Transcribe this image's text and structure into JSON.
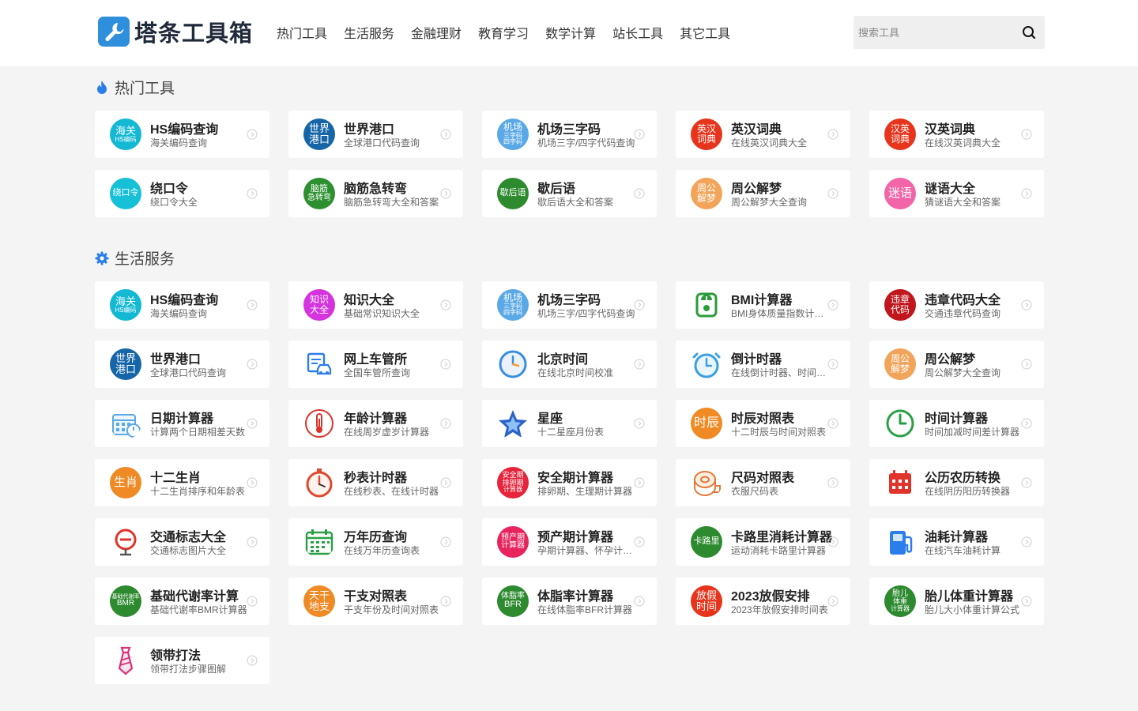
{
  "brand": {
    "logo_text": "塔条工具箱",
    "logo_mark_color": "#2f8fdc"
  },
  "nav": [
    "热门工具",
    "生活服务",
    "金融理财",
    "教育学习",
    "数学计算",
    "站长工具",
    "其它工具"
  ],
  "search": {
    "placeholder": "搜索工具"
  },
  "sections": [
    {
      "title": "热门工具",
      "icon": "flame-icon",
      "icon_color": "#2b7de9",
      "items": [
        {
          "title": "HS编码查询",
          "desc": "海关编码查询",
          "icon": {
            "lines": [
              "海关",
              "HS编码"
            ],
            "bg": "#13b8d3",
            "sizes": [
              13,
              8
            ]
          }
        },
        {
          "title": "世界港口",
          "desc": "全球港口代码查询",
          "icon": {
            "lines": [
              "世界",
              "港口"
            ],
            "bg": "#1565a8",
            "sizes": [
              13,
              13
            ]
          }
        },
        {
          "title": "机场三字码",
          "desc": "机场三字/四字代码查询",
          "icon": {
            "lines": [
              "机场",
              "三字码",
              "四字码"
            ],
            "bg": "#5aa8e6",
            "sizes": [
              12,
              8,
              8
            ]
          }
        },
        {
          "title": "英汉词典",
          "desc": "在线英汉词典大全",
          "icon": {
            "lines": [
              "英汉",
              "词典"
            ],
            "bg": "#e8341c",
            "sizes": [
              12,
              12
            ]
          }
        },
        {
          "title": "汉英词典",
          "desc": "在线汉英词典大全",
          "icon": {
            "lines": [
              "汉英",
              "词典"
            ],
            "bg": "#e8341c",
            "sizes": [
              12,
              12
            ]
          }
        },
        {
          "title": "绕口令",
          "desc": "绕口令大全",
          "icon": {
            "lines": [
              "绕口令"
            ],
            "bg": "#16c0d6",
            "sizes": [
              11
            ]
          }
        },
        {
          "title": "脑筋急转弯",
          "desc": "脑筋急转弯大全和答案",
          "icon": {
            "lines": [
              "脑筋",
              "急转弯"
            ],
            "bg": "#2d8f2f",
            "sizes": [
              11,
              10
            ]
          }
        },
        {
          "title": "歇后语",
          "desc": "歇后语大全和答案",
          "icon": {
            "lines": [
              "歇后语"
            ],
            "bg": "#2d8a2f",
            "sizes": [
              11
            ]
          }
        },
        {
          "title": "周公解梦",
          "desc": "周公解梦大全查询",
          "icon": {
            "lines": [
              "周公",
              "解梦"
            ],
            "bg": "#f2a55a",
            "sizes": [
              12,
              12
            ]
          }
        },
        {
          "title": "谜语大全",
          "desc": "猜谜语大全和答案",
          "icon": {
            "lines": [
              "迷语"
            ],
            "bg": "#f265a8",
            "sizes": [
              15
            ]
          }
        }
      ]
    },
    {
      "title": "生活服务",
      "icon": "gear-icon",
      "icon_color": "#2b7de9",
      "items": [
        {
          "title": "HS编码查询",
          "desc": "海关编码查询",
          "icon": {
            "lines": [
              "海关",
              "HS编码"
            ],
            "bg": "#13b8d3",
            "sizes": [
              13,
              8
            ]
          }
        },
        {
          "title": "知识大全",
          "desc": "基础常识知识大全",
          "icon": {
            "lines": [
              "知识",
              "大全"
            ],
            "bg": "#d633e0",
            "sizes": [
              12,
              12
            ]
          }
        },
        {
          "title": "机场三字码",
          "desc": "机场三字/四字代码查询",
          "icon": {
            "lines": [
              "机场",
              "三字码",
              "四字码"
            ],
            "bg": "#5aa8e6",
            "sizes": [
              12,
              8,
              8
            ]
          }
        },
        {
          "title": "BMI计算器",
          "desc": "BMI身体质量指数计算器",
          "icon": {
            "glyph": "scale-icon",
            "color": "#2a9b3a"
          }
        },
        {
          "title": "违章代码大全",
          "desc": "交通违章代码查询",
          "icon": {
            "lines": [
              "违章",
              "代码"
            ],
            "bg": "#c0161c",
            "sizes": [
              12,
              12
            ]
          }
        },
        {
          "title": "世界港口",
          "desc": "全球港口代码查询",
          "icon": {
            "lines": [
              "世界",
              "港口"
            ],
            "bg": "#1565a8",
            "sizes": [
              13,
              13
            ]
          }
        },
        {
          "title": "网上车管所",
          "desc": "全国车管所查询",
          "icon": {
            "glyph": "car-icon",
            "color": "#2b7de9"
          }
        },
        {
          "title": "北京时间",
          "desc": "在线北京时间校准",
          "icon": {
            "glyph": "clock-icon",
            "color": "#3a8de0"
          }
        },
        {
          "title": "倒计时器",
          "desc": "在线倒计时器、时间倒计时",
          "icon": {
            "glyph": "alarm-icon",
            "color": "#3aa0e0"
          }
        },
        {
          "title": "周公解梦",
          "desc": "周公解梦大全查询",
          "icon": {
            "lines": [
              "周公",
              "解梦"
            ],
            "bg": "#f2a55a",
            "sizes": [
              12,
              12
            ]
          }
        },
        {
          "title": "日期计算器",
          "desc": "计算两个日期相差天数",
          "icon": {
            "glyph": "calendar-icon",
            "color": "#5aa8e6"
          }
        },
        {
          "title": "年龄计算器",
          "desc": "在线周岁虚岁计算器",
          "icon": {
            "glyph": "thermometer-icon",
            "color": "#d9342b"
          }
        },
        {
          "title": "星座",
          "desc": "十二星座月份表",
          "icon": {
            "glyph": "star-icon",
            "color": "#2b63c9"
          }
        },
        {
          "title": "时辰对照表",
          "desc": "十二时辰与时间对照表",
          "icon": {
            "lines": [
              "时辰"
            ],
            "bg": "#f08a24",
            "sizes": [
              16
            ]
          }
        },
        {
          "title": "时间计算器",
          "desc": "时间加减时间差计算器",
          "icon": {
            "glyph": "timer-icon",
            "color": "#2aa046"
          }
        },
        {
          "title": "十二生肖",
          "desc": "十二生肖排序和年龄表",
          "icon": {
            "lines": [
              "生肖"
            ],
            "bg": "#ef8a24",
            "sizes": [
              15
            ]
          }
        },
        {
          "title": "秒表计时器",
          "desc": "在线秒表、在线计时器",
          "icon": {
            "glyph": "stopwatch-icon",
            "color": "#e0482b"
          }
        },
        {
          "title": "安全期计算器",
          "desc": "排卵期、生理期计算器",
          "icon": {
            "lines": [
              "安全期",
              "排卵期",
              "计算器"
            ],
            "bg": "#e8243c",
            "sizes": [
              9,
              9,
              8
            ]
          }
        },
        {
          "title": "尺码对照表",
          "desc": "衣服尺码表",
          "icon": {
            "glyph": "tape-icon",
            "color": "#e07a3a"
          }
        },
        {
          "title": "公历农历转换",
          "desc": "在线阴历阳历转换器",
          "icon": {
            "glyph": "calendar-red-icon",
            "color": "#e0342b"
          }
        },
        {
          "title": "交通标志大全",
          "desc": "交通标志图片大全",
          "icon": {
            "glyph": "sign-icon",
            "color": "#e0342b"
          }
        },
        {
          "title": "万年历查询",
          "desc": "在线万年历查询表",
          "icon": {
            "glyph": "calendar-green-icon",
            "color": "#2aa046"
          }
        },
        {
          "title": "预产期计算器",
          "desc": "孕期计算器、怀孕计算器",
          "icon": {
            "lines": [
              "预产期",
              "计算器"
            ],
            "bg": "#e8245c",
            "sizes": [
              10,
              10
            ]
          }
        },
        {
          "title": "卡路里消耗计算器",
          "desc": "运动消耗卡路里计算器",
          "icon": {
            "lines": [
              "卡路里"
            ],
            "bg": "#2d8a2f",
            "sizes": [
              11
            ]
          }
        },
        {
          "title": "油耗计算器",
          "desc": "在线汽车油耗计算",
          "icon": {
            "glyph": "fuel-icon",
            "color": "#2b7de9"
          }
        },
        {
          "title": "基础代谢率计算",
          "desc": "基础代谢率BMR计算器",
          "icon": {
            "lines": [
              "基础代谢率",
              "BMR"
            ],
            "bg": "#2d8a2f",
            "sizes": [
              7,
              10
            ]
          }
        },
        {
          "title": "干支对照表",
          "desc": "干支年份及时间对照表",
          "icon": {
            "lines": [
              "天干",
              "地支"
            ],
            "bg": "#ef8a24",
            "sizes": [
              13,
              13
            ]
          }
        },
        {
          "title": "体脂率计算器",
          "desc": "在线体脂率BFR计算器",
          "icon": {
            "lines": [
              "体脂率",
              "BFR"
            ],
            "bg": "#2d8a2f",
            "sizes": [
              10,
              11
            ]
          }
        },
        {
          "title": "2023放假安排",
          "desc": "2023年放假安排时间表",
          "icon": {
            "lines": [
              "放假",
              "时间"
            ],
            "bg": "#e8341c",
            "sizes": [
              13,
              13
            ]
          }
        },
        {
          "title": "胎儿体重计算器",
          "desc": "胎儿大小体重计算公式",
          "icon": {
            "lines": [
              "胎儿",
              "体重",
              "计算器"
            ],
            "bg": "#2d8a2f",
            "sizes": [
              10,
              9,
              8
            ]
          }
        },
        {
          "title": "领带打法",
          "desc": "领带打法步骤图解",
          "icon": {
            "glyph": "tie-icon",
            "color": "#d9347a"
          }
        }
      ]
    }
  ]
}
